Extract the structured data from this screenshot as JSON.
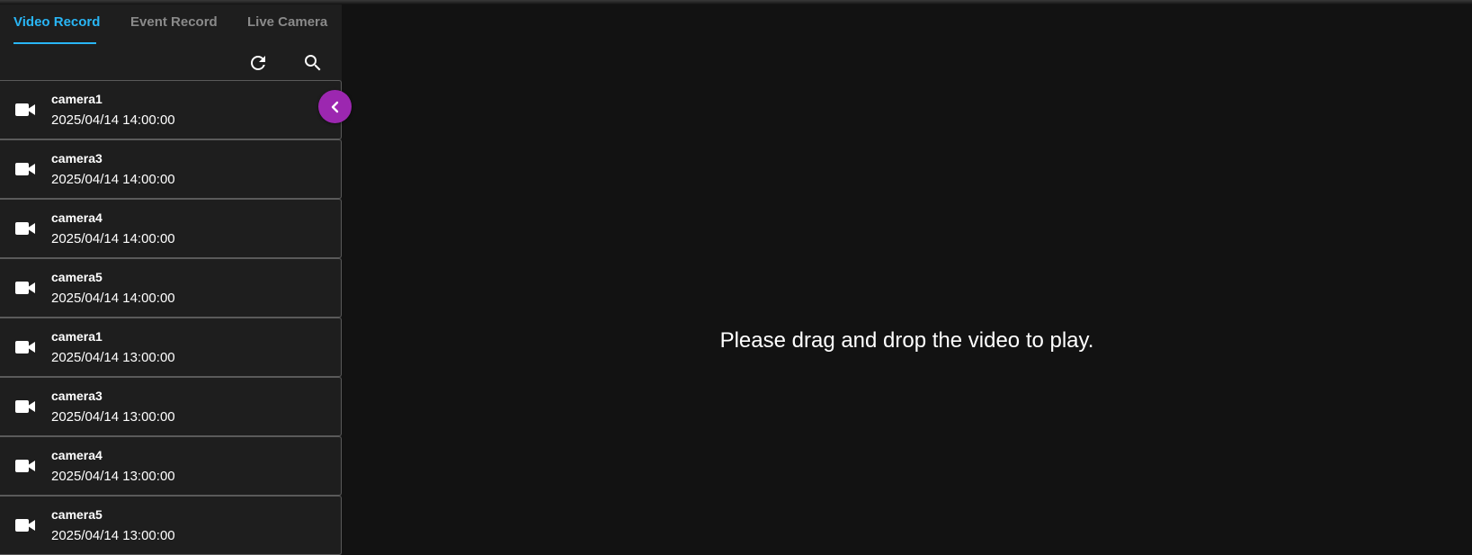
{
  "tabs": [
    {
      "label": "Video Record",
      "active": true
    },
    {
      "label": "Event Record",
      "active": false
    },
    {
      "label": "Live Camera",
      "active": false
    }
  ],
  "toolbar": {
    "refresh_icon": "refresh-icon",
    "search_icon": "search-icon"
  },
  "records": [
    {
      "name": "camera1",
      "time": "2025/04/14 14:00:00",
      "icon": "videocam-icon"
    },
    {
      "name": "camera3",
      "time": "2025/04/14 14:00:00",
      "icon": "videocam-icon"
    },
    {
      "name": "camera4",
      "time": "2025/04/14 14:00:00",
      "icon": "videocam-icon"
    },
    {
      "name": "camera5",
      "time": "2025/04/14 14:00:00",
      "icon": "videocam-icon"
    },
    {
      "name": "camera1",
      "time": "2025/04/14 13:00:00",
      "icon": "videocam-icon"
    },
    {
      "name": "camera3",
      "time": "2025/04/14 13:00:00",
      "icon": "videocam-icon"
    },
    {
      "name": "camera4",
      "time": "2025/04/14 13:00:00",
      "icon": "videocam-icon"
    },
    {
      "name": "camera5",
      "time": "2025/04/14 13:00:00",
      "icon": "videocam-icon"
    }
  ],
  "collapse_button": {
    "icon": "chevron-left-icon"
  },
  "main": {
    "placeholder": "Please drag and drop the video to play."
  },
  "colors": {
    "accent": "#29b6f6",
    "collapse_button": "#9c27b0",
    "sidebar_bg": "#1e1e1e",
    "main_bg": "#121212"
  }
}
